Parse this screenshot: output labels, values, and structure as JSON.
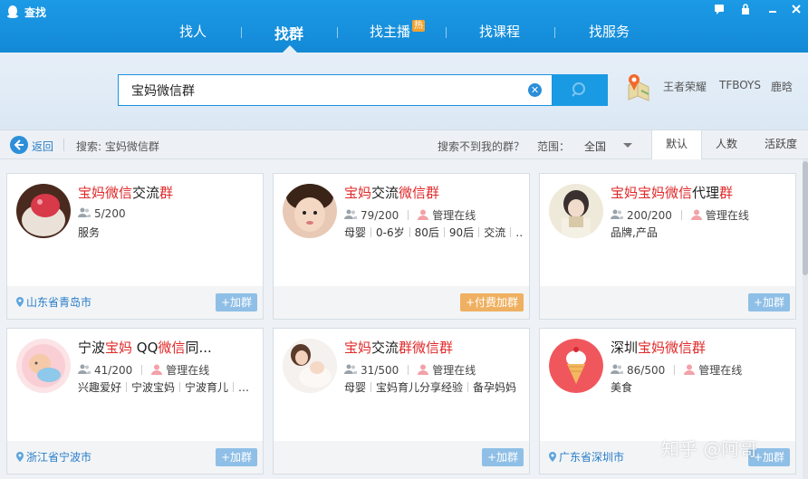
{
  "window": {
    "title": "查找",
    "controls": [
      "feedback-icon",
      "lock-icon",
      "minimize-icon",
      "close-icon"
    ]
  },
  "tabs": [
    {
      "label": "找人"
    },
    {
      "label": "找群",
      "active": true
    },
    {
      "label": "找主播",
      "badge": "热"
    },
    {
      "label": "找课程"
    },
    {
      "label": "找服务"
    }
  ],
  "search": {
    "value": "宝妈微信群",
    "hot_words": [
      "王者荣耀",
      "TFBOYS",
      "鹿晗"
    ]
  },
  "filter": {
    "back_label": "返回",
    "search_info": "搜索: 宝妈微信群",
    "not_found": "搜索不到我的群？",
    "range_label": "范围：",
    "range_value": "全国",
    "sort_tabs": [
      "默认",
      "人数",
      "活跃度"
    ]
  },
  "cards": [
    {
      "title_parts": [
        [
          "宝妈",
          1
        ],
        [
          "微信",
          1
        ],
        [
          "交流",
          0
        ],
        [
          "群",
          1
        ]
      ],
      "members": "5/200",
      "admin": "",
      "tags": [
        "服务"
      ],
      "location": "山东省青岛市",
      "join": "+加群",
      "paid": false
    },
    {
      "title_parts": [
        [
          "宝妈",
          1
        ],
        [
          "交流",
          0
        ],
        [
          "微信群",
          1
        ]
      ],
      "members": "79/200",
      "admin": "管理在线",
      "tags": [
        "母婴",
        "0-6岁",
        "80后",
        "90后",
        "交流",
        "…"
      ],
      "location": "",
      "join": "+付费加群",
      "paid": true
    },
    {
      "title_parts": [
        [
          "宝妈宝妈微信",
          1
        ],
        [
          "代理",
          0
        ],
        [
          "群",
          1
        ]
      ],
      "members": "200/200",
      "admin": "管理在线",
      "tags": [
        "品牌,产品"
      ],
      "location": "",
      "join": "+加群",
      "paid": false
    },
    {
      "title_parts": [
        [
          "宁波",
          0
        ],
        [
          "宝妈",
          1
        ],
        [
          " QQ",
          0
        ],
        [
          "微信",
          1
        ],
        [
          "同...",
          0
        ]
      ],
      "members": "41/200",
      "admin": "管理在线",
      "tags": [
        "兴趣爱好",
        "宁波宝妈",
        "宁波育儿",
        "…"
      ],
      "location": "浙江省宁波市",
      "join": "+加群",
      "paid": false
    },
    {
      "title_parts": [
        [
          "宝妈",
          1
        ],
        [
          "交流",
          0
        ],
        [
          "群微信群",
          1
        ]
      ],
      "members": "31/500",
      "admin": "管理在线",
      "tags": [
        "母婴",
        "宝妈育儿分享经验",
        "备孕妈妈"
      ],
      "location": "",
      "join": "+加群",
      "paid": false
    },
    {
      "title_parts": [
        [
          "深圳",
          0
        ],
        [
          "宝妈微信群",
          1
        ]
      ],
      "members": "86/500",
      "admin": "管理在线",
      "tags": [
        "美食"
      ],
      "location": "广东省深圳市",
      "join": "+加群",
      "paid": false
    }
  ],
  "watermark": "知乎 @阿哥",
  "colors": {
    "accent": "#1a9ae3",
    "highlight": "#e0292a",
    "paid": "#efb061"
  }
}
